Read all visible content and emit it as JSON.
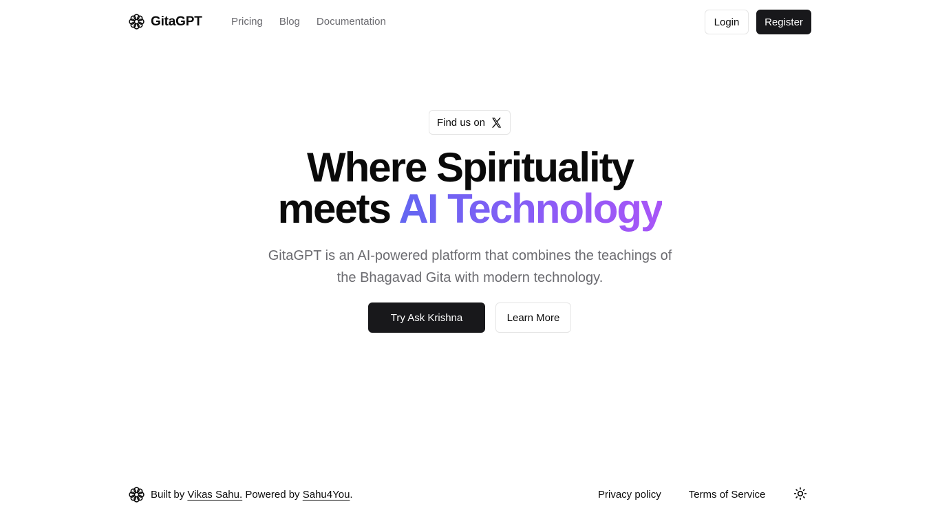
{
  "header": {
    "brand_name": "GitaGPT",
    "brand_icon": "flower-logo-icon",
    "nav": [
      {
        "label": "Pricing"
      },
      {
        "label": "Blog"
      },
      {
        "label": "Documentation"
      }
    ],
    "login_label": "Login",
    "register_label": "Register"
  },
  "hero": {
    "pill_label": "Find us on",
    "pill_icon": "x-logo-icon",
    "headline_line1": "Where Spirituality",
    "headline_line2_prefix": "meets ",
    "headline_line2_highlight": "AI Technology",
    "subtitle": "GitaGPT is an AI-powered platform that combines the teachings of the Bhagavad Gita with modern technology.",
    "primary_cta": "Try Ask Krishna",
    "secondary_cta": "Learn More"
  },
  "footer": {
    "built_by_prefix": "Built by",
    "author": "Vikas Sahu.",
    "powered_by_prefix": "Powered by",
    "powered_by": "Sahu4You",
    "period": ".",
    "links": [
      {
        "label": "Privacy policy"
      },
      {
        "label": "Terms of Service"
      }
    ],
    "theme_icon": "sun-icon"
  },
  "colors": {
    "primary_dark": "#18181b",
    "muted_text": "#6b6b70",
    "gradient_start": "#6366f1",
    "gradient_end": "#a855f7",
    "border": "#e5e5e5"
  }
}
